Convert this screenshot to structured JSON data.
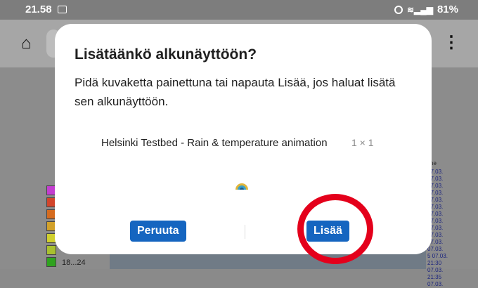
{
  "status_bar": {
    "time": "21.58",
    "battery": "81%"
  },
  "background": {
    "legend_label": "18...24",
    "legend_colors": [
      "#c33ed0",
      "#d2452b",
      "#d56b1f",
      "#d2a12a",
      "#d0cf2e",
      "#a8c02f",
      "#2fa31f"
    ],
    "time_header": "ime",
    "times": [
      "07.03.",
      "07.03.",
      "07.03.",
      "07.03.",
      "07.03.",
      "07.03.",
      "07.03.",
      "07.03.",
      "07.03.",
      "07.03.",
      "07.03.",
      "07.03.",
      "5 07.03.",
      "21:30 07.03.",
      "21:35 07.03."
    ]
  },
  "dialog": {
    "title": "Lisätäänkö alkunäyttöön?",
    "body": "Pidä kuvaketta painettuna tai napauta Lisää, jos haluat lisätä sen alkunäyttöön.",
    "app_name": "Helsinki Testbed - Rain & temperature animation",
    "app_size": "1 × 1",
    "cancel_label": "Peruuta",
    "add_label": "Lisää"
  },
  "colors": {
    "accent": "#1565c0",
    "highlight": "#e4001b"
  }
}
